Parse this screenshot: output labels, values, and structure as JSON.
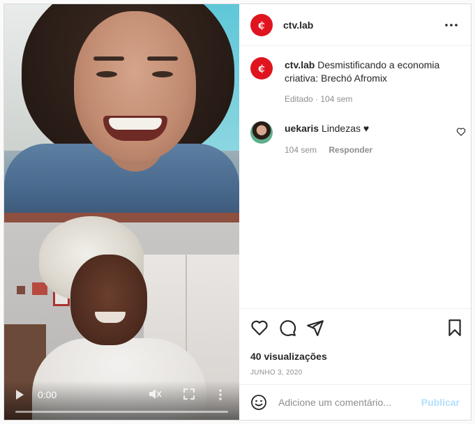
{
  "post": {
    "username": "ctv.lab",
    "logo_glyph": "¢",
    "caption_text": "Desmistificando a economia criativa: Brechó Afromix",
    "caption_meta": "Editado · 104 sem"
  },
  "video": {
    "time": "0:00",
    "progress": 0
  },
  "comments": [
    {
      "username": "uekaris",
      "text": "Lindezas ♥",
      "time": "104 sem",
      "reply_label": "Responder"
    }
  ],
  "actions": {
    "views": "40 visualizações",
    "date": "JUNHO 3, 2020"
  },
  "add_comment": {
    "placeholder": "Adicione um comentário...",
    "post_label": "Publicar"
  },
  "colors": {
    "brand_red": "#e0141e",
    "post_button_disabled": "#b2dffc"
  }
}
